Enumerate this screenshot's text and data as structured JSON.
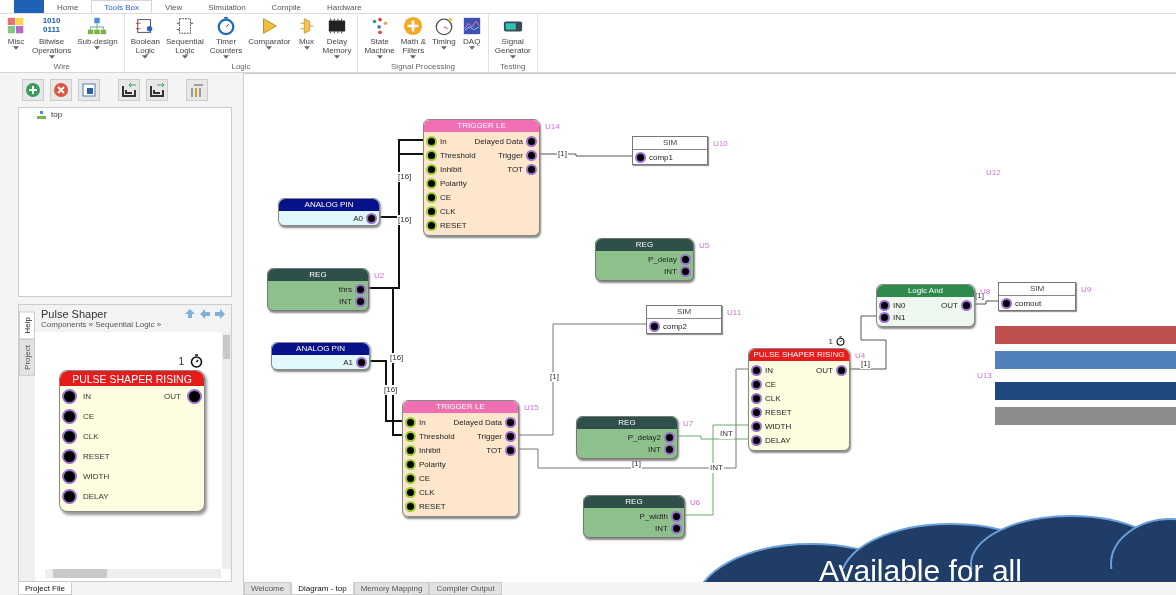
{
  "ribbon": {
    "tabs": [
      {
        "label": "Home",
        "selected": false
      },
      {
        "label": "Tools Box",
        "selected": true
      },
      {
        "label": "View",
        "selected": false
      },
      {
        "label": "Simulation",
        "selected": false
      },
      {
        "label": "Compile",
        "selected": false
      },
      {
        "label": "Hardware",
        "selected": false
      }
    ],
    "groups": [
      {
        "label": "Wire",
        "tools": [
          {
            "lines": [
              "Misc"
            ],
            "dropdown": true
          },
          {
            "lines": [
              "Bitwise",
              "Operations"
            ],
            "dropdown": true,
            "icon_text": [
              "1010",
              "0111"
            ]
          },
          {
            "lines": [
              "Sub-design"
            ],
            "dropdown": true
          }
        ]
      },
      {
        "label": "Logic",
        "tools": [
          {
            "lines": [
              "Boolean",
              "Logic"
            ],
            "dropdown": true
          },
          {
            "lines": [
              "Sequential",
              "Logic"
            ],
            "dropdown": true
          },
          {
            "lines": [
              "Timer",
              "Counters"
            ],
            "dropdown": true
          },
          {
            "lines": [
              "Comparator"
            ],
            "dropdown": true
          },
          {
            "lines": [
              "Mux"
            ],
            "dropdown": true
          },
          {
            "lines": [
              "Delay",
              "Memory"
            ],
            "dropdown": true
          }
        ]
      },
      {
        "label": "Signal Processing",
        "tools": [
          {
            "lines": [
              "State",
              "Machine"
            ],
            "dropdown": true
          },
          {
            "lines": [
              "Math &",
              "Filters"
            ],
            "dropdown": true
          },
          {
            "lines": [
              "Timing"
            ],
            "dropdown": true
          },
          {
            "lines": [
              "DAQ"
            ],
            "dropdown": true
          }
        ]
      },
      {
        "label": "Testing",
        "tools": [
          {
            "lines": [
              "Signal",
              "Generator"
            ],
            "dropdown": true
          }
        ]
      }
    ]
  },
  "tree": {
    "items": [
      {
        "label": "top"
      }
    ]
  },
  "help": {
    "side_tabs": [
      {
        "label": "Help",
        "selected": true
      },
      {
        "label": "Project",
        "selected": false
      }
    ],
    "title": "Pulse Shaper",
    "breadcrumb": "Components » Sequential Logic »",
    "preview": {
      "kind": "pulse",
      "count": "1",
      "title": "PULSE SHAPER RISING",
      "inputs": [
        "IN",
        "CE",
        "CLK",
        "RESET",
        "WIDTH",
        "DELAY"
      ],
      "outputs": [
        "OUT"
      ]
    }
  },
  "left_tabs": [
    {
      "label": "Project File",
      "selected": true
    }
  ],
  "diagram": {
    "blocks": [
      {
        "kind": "trigger",
        "title": "TRIGGER LE",
        "ref": "U14",
        "inputs": [
          "In",
          "Threshold",
          "Inhibit",
          "Polarity",
          "CE",
          "CLK",
          "RESET"
        ],
        "outputs": [
          "Delayed Data",
          "Trigger",
          "TOT"
        ]
      },
      {
        "kind": "sim",
        "title": "SIM",
        "ref": "U10",
        "inputs": [
          "comp1"
        ]
      },
      {
        "kind": "analog",
        "title": "ANALOG PIN",
        "outputs": [
          "A0"
        ]
      },
      {
        "kind": "reg",
        "title": "REG",
        "ref": "U2",
        "outputs": [
          "thrs",
          "INT"
        ]
      },
      {
        "kind": "reg",
        "title": "REG",
        "ref": "U5",
        "outputs": [
          "P_delay",
          "INT"
        ]
      },
      {
        "kind": "analog",
        "title": "ANALOG PIN",
        "outputs": [
          "A1"
        ]
      },
      {
        "kind": "sim",
        "title": "SIM",
        "ref": "U11",
        "inputs": [
          "comp2"
        ]
      },
      {
        "kind": "trigger",
        "title": "TRIGGER LE",
        "ref": "U15",
        "inputs": [
          "In",
          "Threshold",
          "Inhibit",
          "Polarity",
          "CE",
          "CLK",
          "RESET"
        ],
        "outputs": [
          "Delayed Data",
          "Trigger",
          "TOT"
        ]
      },
      {
        "kind": "reg",
        "title": "REG",
        "ref": "U7",
        "outputs": [
          "P_delay2",
          "INT"
        ]
      },
      {
        "kind": "reg",
        "title": "REG",
        "ref": "U6",
        "outputs": [
          "P_width",
          "INT"
        ]
      },
      {
        "kind": "pulse",
        "title": "PULSE SHAPER RISING",
        "ref": "U4",
        "count": "1",
        "inputs": [
          "IN",
          "CE",
          "CLK",
          "RESET",
          "WIDTH",
          "DELAY"
        ],
        "outputs": [
          "OUT"
        ]
      },
      {
        "kind": "and",
        "title": "Logic And",
        "ref": "U8",
        "inputs": [
          "IN0",
          "IN1"
        ],
        "outputs": [
          "OUT"
        ]
      },
      {
        "kind": "sim",
        "title": "SIM",
        "ref": "U9",
        "inputs": [
          "comout"
        ]
      }
    ],
    "refs": [
      "U12"
    ],
    "wire_labels": [
      "[1]",
      "[16]",
      "[16]",
      "[16]",
      "[16]",
      "[1]",
      "[1]",
      "INT",
      "INT",
      "[1]",
      "[1]"
    ],
    "legend": {
      "ref": "U13",
      "bars": [
        {
          "color": "#c0504d"
        },
        {
          "color": "#4f81bd"
        },
        {
          "color": "#1f497d"
        },
        {
          "color": "#8c8c8c"
        }
      ]
    }
  },
  "doc_tabs": [
    {
      "label": "Welcome",
      "selected": false
    },
    {
      "label": "Diagram - top",
      "selected": true
    },
    {
      "label": "Memory Mapping",
      "selected": false
    },
    {
      "label": "Compiler Output",
      "selected": false
    }
  ],
  "banner": {
    "text": "Available for all"
  }
}
